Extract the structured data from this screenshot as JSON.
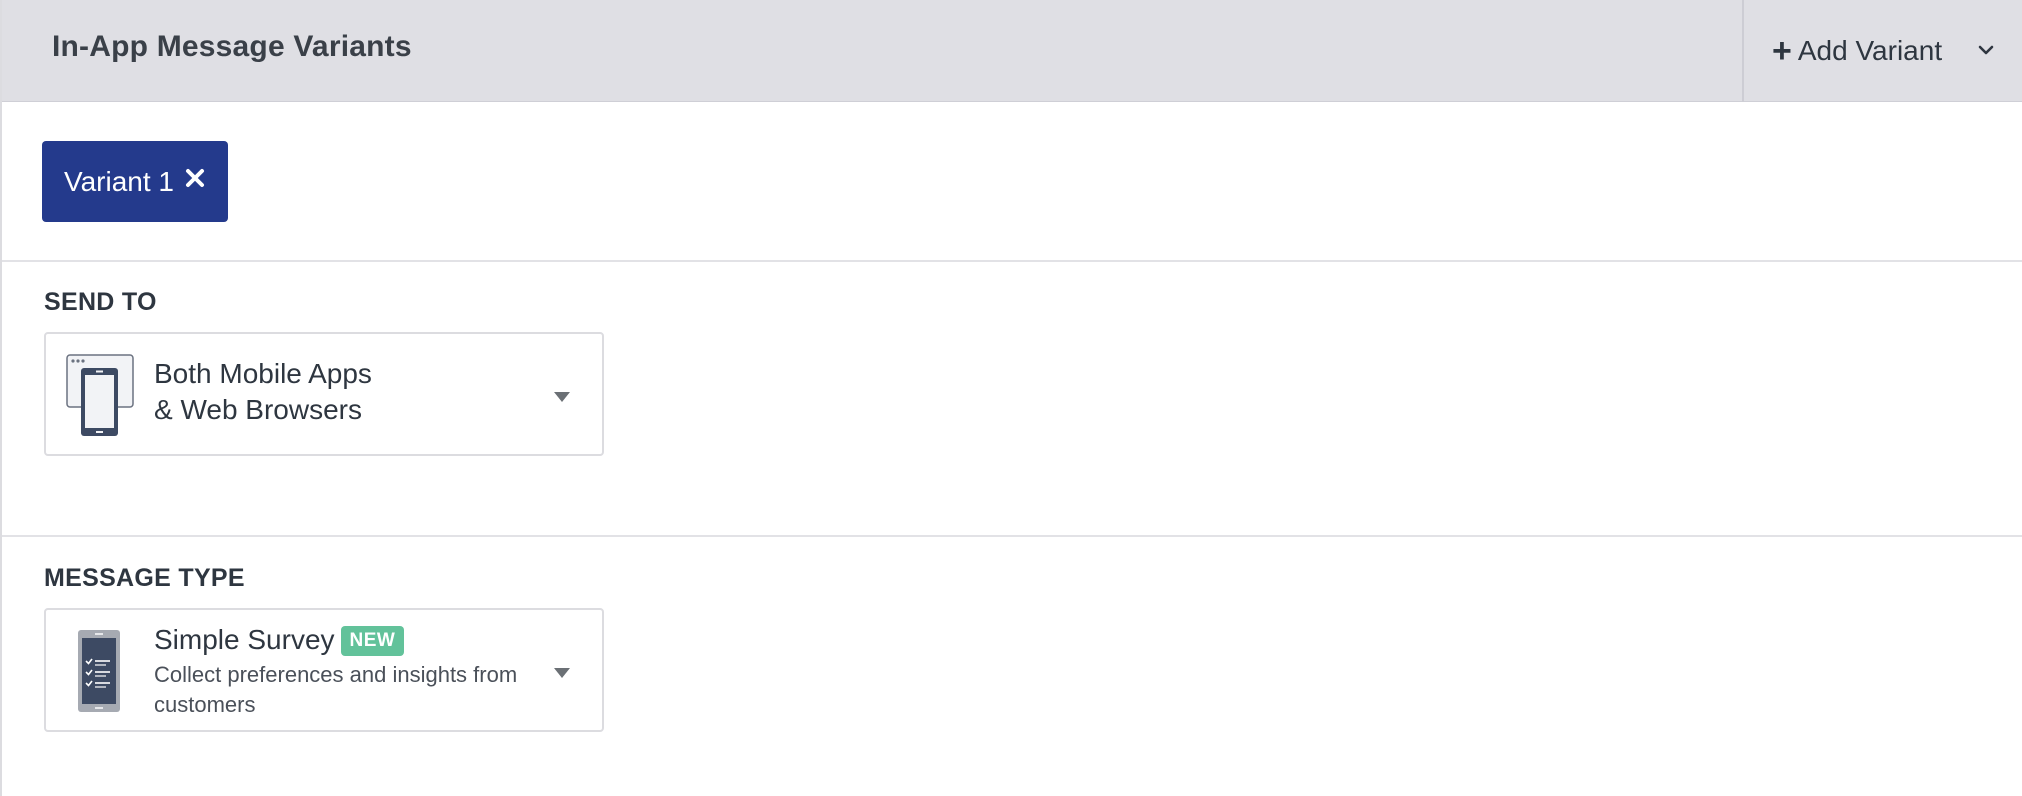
{
  "header": {
    "title": "In-App Message Variants",
    "add_variant_label": "Add Variant"
  },
  "variants": [
    {
      "label": "Variant 1"
    }
  ],
  "send_to": {
    "section_label": "SEND TO",
    "selected_line1": "Both Mobile Apps",
    "selected_line2": "& Web Browsers",
    "icon": "mobile-and-web-icon"
  },
  "message_type": {
    "section_label": "MESSAGE TYPE",
    "selected_title": "Simple Survey",
    "badge": "NEW",
    "selected_description": "Collect preferences and insights from customers",
    "icon": "survey-phone-icon"
  },
  "colors": {
    "header_bg": "#dfdfe4",
    "variant_tab_bg": "#243a8c",
    "new_badge_bg": "#62c29a"
  }
}
